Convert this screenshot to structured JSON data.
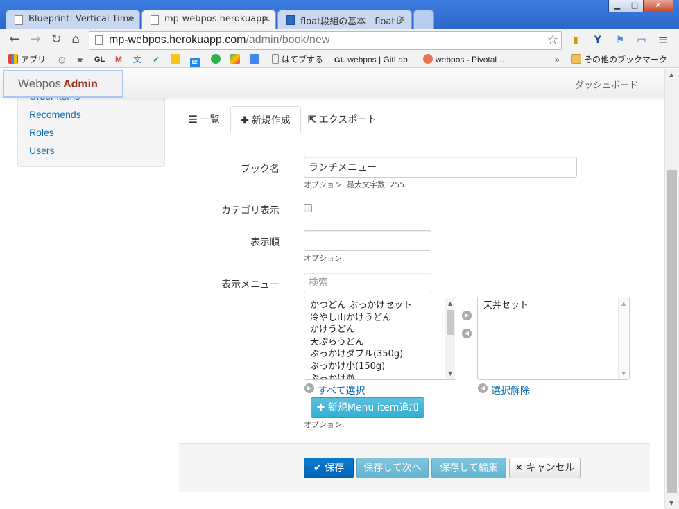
{
  "window": {
    "minimize": "▁",
    "maximize": "□",
    "close": "✕"
  },
  "tabs": [
    {
      "label": "Blueprint: Vertical Time",
      "close": "×"
    },
    {
      "label": "mp-webpos.herokuapp.",
      "close": "×"
    },
    {
      "label": "float段組の基本｜floatレ",
      "close": "×"
    }
  ],
  "address": {
    "host": "mp-webpos.herokuapp.com",
    "path": "/admin/book/new"
  },
  "bookmarks": {
    "apps": "アプリ",
    "gl": "GL",
    "b": "B!",
    "hatebu": "はてブする",
    "gitlab": "webpos | GitLab",
    "pivotal": "webpos - Pivotal …",
    "more": "»",
    "other": "その他のブックマーク"
  },
  "navbar": {
    "brand": "Webpos",
    "brand_suffix": "Admin",
    "dashboard": "ダッシュボード"
  },
  "sidebar": {
    "items": [
      {
        "label": "Order items"
      },
      {
        "label": "Recomends"
      },
      {
        "label": "Roles"
      },
      {
        "label": "Users"
      }
    ]
  },
  "content_tabs": [
    {
      "label": "一覧"
    },
    {
      "label": "新規作成"
    },
    {
      "label": "エクスポート"
    }
  ],
  "form": {
    "book_name": {
      "label": "ブック名",
      "value": "ランチメニュー",
      "help": "オプション. 最大文字数: 255."
    },
    "category_display": {
      "label": "カテゴリ表示",
      "checked": false
    },
    "display_order": {
      "label": "表示順",
      "value": "",
      "help": "オプション."
    },
    "display_menu": {
      "label": "表示メニュー",
      "search_placeholder": "検索",
      "available": [
        "かつどん ぶっかけセット",
        "冷やし山かけうどん",
        "かけうどん",
        "天ぷらうどん",
        "ぶっかけダブル(350g)",
        "ぶっかけ小(150g)",
        "ぶっかけ並"
      ],
      "selected": [
        "天丼セット"
      ],
      "select_all": "すべて選択",
      "deselect": "選択解除",
      "add_button": "新規Menu item追加",
      "help": "オプション."
    }
  },
  "actions": {
    "save": "保存",
    "save_next": "保存して次へ",
    "save_edit": "保存して編集",
    "cancel": "キャンセル"
  },
  "colors": {
    "link": "#0d6fb8",
    "brand_admin": "#a12b1c",
    "primary": "#0064b8",
    "info": "#31b0d5"
  }
}
